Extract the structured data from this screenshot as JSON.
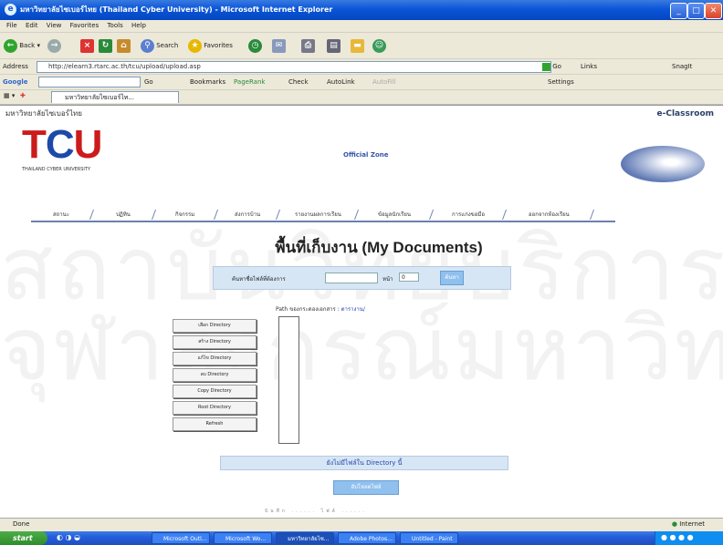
{
  "window": {
    "title": "มหาวิทยาลัยไซเบอร์ไทย (Thailand Cyber University) - Microsoft Internet Explorer",
    "minimize": "_",
    "maximize": "□",
    "close": "✕"
  },
  "menu": [
    "File",
    "Edit",
    "View",
    "Favorites",
    "Tools",
    "Help"
  ],
  "toolbar": {
    "back": "Back",
    "search": "Search",
    "favorites": "Favorites"
  },
  "address": {
    "label": "Address",
    "url": "http://elearn3.rtarc.ac.th/tcu/upload/upload.asp",
    "go": "Go",
    "links": "Links",
    "snagit": "SnagIt"
  },
  "google_bar": {
    "logo": "Google",
    "go": "Go",
    "bookmarks": "Bookmarks",
    "pagerank": "PageRank",
    "check": "Check",
    "autolink": "AutoLink",
    "autofill": "AutoFill",
    "settings": "Settings"
  },
  "tab": {
    "label": "มหาวิทยาลัยไซเบอร์ไท..."
  },
  "site": {
    "university_name": "มหาวิทยาลัยไซเบอร์ไทย",
    "eclassroom": "e-Classroom",
    "logo_text": "TCU",
    "logo_sub": "THAILAND CYBER UNIVERSITY",
    "official_zone": "Official Zone"
  },
  "nav": [
    "สถานะ",
    "ปฏิทิน",
    "กิจกรรม",
    "ส่งการบ้าน",
    "รายงานผลการเรียน",
    "ข้อมูลนักเรียน",
    "การแก่งขอมือ",
    "ออกจากห้องเรียน"
  ],
  "page": {
    "title": "พื้นที่เก็บงาน (My Documents)",
    "watermark1": "สถาบันวิทยบริการ",
    "watermark2": "จุฬาลงกรณ์มหาวิทยาลัย",
    "search_label": "ค้นหาชื่อไฟล์ที่ต้องการ",
    "page_label": "หน้า",
    "page_value": "0",
    "search_button": "ค้นหา",
    "path_label": "Path ของกระดองเอกสาร :",
    "path_value": "ตารางาน/",
    "dir_buttons": [
      "เลือก Directory",
      "สร้าง Directory",
      "แก้ไข Directory",
      "ลบ Directory",
      "Copy Directory",
      "Root Directory",
      "Refresh"
    ],
    "info_bar": "ยังไม่มีไฟล์ใน Directory นี้",
    "upload_button": "อัปโหลดไฟล์",
    "footer": "บันทึก ...... ไฟล์ ......"
  },
  "status": {
    "left": "Done",
    "right": "Internet"
  },
  "taskbar": {
    "start": "start",
    "tasks": [
      "Microsoft Outl...",
      "Microsoft Wo...",
      "มหาวิทยาลัยไซ...",
      "Adobe Photos...",
      "Untitled - Paint"
    ]
  }
}
